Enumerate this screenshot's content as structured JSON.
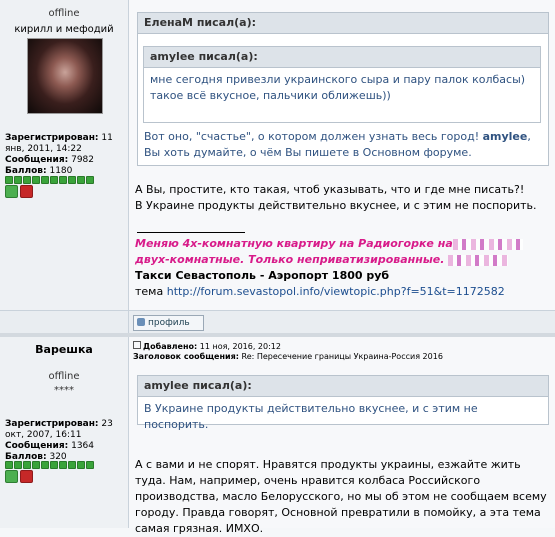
{
  "post1": {
    "user": {
      "status": "offline",
      "name": "кирилл и мефодий",
      "registered_label": "Зарегистрирован:",
      "registered_value": "11 янв, 2011, 14:22",
      "messages_label": "Сообщения:",
      "messages_value": "7982",
      "points_label": "Баллов:",
      "points_value": "1180",
      "rating_dots": 10
    },
    "quote_outer_header": "ЕленаМ писал(а):",
    "quote_inner_header": "amylee писал(а):",
    "quote_inner_text": "мне сегодня привезли украинского сыра и пару палок колбасы) такое всё вкусное, пальчики оближешь))",
    "quote_outer_text_a": "Вот оно, \"счастье\", о котором должен узнать весь город! ",
    "quote_outer_text_name": "amylee",
    "quote_outer_text_b": ", Вы хоть думайте, о чём Вы пишете в Основном форуме.",
    "body_line1": "А Вы, простите, кто такая, чтоб указывать, что и где мне писать?!",
    "body_line2": "В Украине продукты действительно вкуснее, и с этим не поспорить.",
    "signature": {
      "line1": "Меняю 4х-комнатную квартиру на Радиогорке на",
      "line2": "двух-комнатные. Только неприватизированные.",
      "line3": "Такси Севастополь - Аэропорт 1800 руб",
      "line4_prefix": "тема ",
      "line4_link": "http://forum.sevastopol.info/viewtopic.php?f=51&t=1172582"
    },
    "profile_button": "профиль"
  },
  "post2": {
    "user": {
      "name": "Варешка",
      "status": "offline",
      "stars": "****",
      "registered_label": "Зарегистрирован:",
      "registered_value": "23 окт, 2007, 16:11",
      "messages_label": "Сообщения:",
      "messages_value": "1364",
      "points_label": "Баллов:",
      "points_value": "320",
      "rating_dots": 10
    },
    "added_label": "Добавлено:",
    "added_value": "11 ноя, 2016, 20:12",
    "subject_label": "Заголовок сообщения:",
    "subject_value": "Re: Пересечение границы Украина-Россия 2016",
    "quote_header": "amylee писал(а):",
    "quote_text": "В Украине продукты действительно вкуснее, и с этим не поспорить.",
    "body": "А с вами и не спорят. Нравятся продукты украины, езжайте жить туда. Нам, например, очень нравится колбаса Российского производства, масло Белорусского, но мы об этом не сообщаем всему городу. Правда говорят, Основной превратили в помойку, а эта тема самая грязная. ИМХО."
  },
  "colors": {
    "quote_text": "#2f5280",
    "signature_pink": "#d81b8a",
    "link": "#1d4e8f",
    "rating_green": "#3aa33a"
  }
}
